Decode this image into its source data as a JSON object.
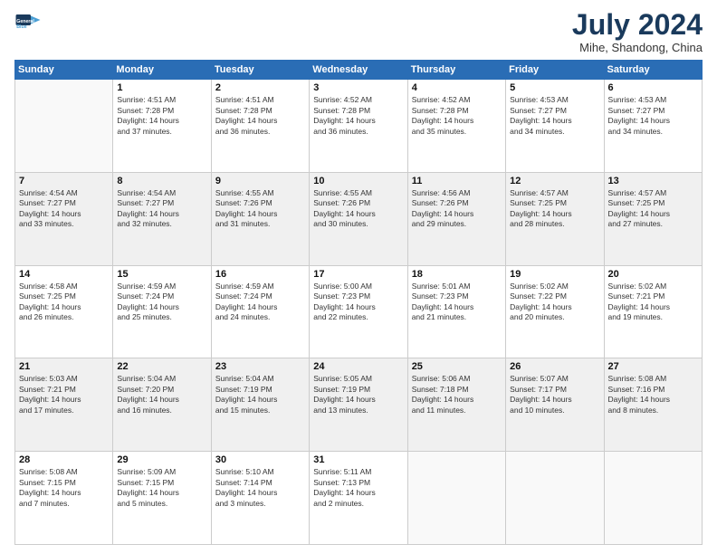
{
  "logo": {
    "line1": "General",
    "line2": "Blue"
  },
  "title": "July 2024",
  "subtitle": "Mihe, Shandong, China",
  "days_header": [
    "Sunday",
    "Monday",
    "Tuesday",
    "Wednesday",
    "Thursday",
    "Friday",
    "Saturday"
  ],
  "weeks": [
    [
      {
        "day": "",
        "info": ""
      },
      {
        "day": "1",
        "info": "Sunrise: 4:51 AM\nSunset: 7:28 PM\nDaylight: 14 hours\nand 37 minutes."
      },
      {
        "day": "2",
        "info": "Sunrise: 4:51 AM\nSunset: 7:28 PM\nDaylight: 14 hours\nand 36 minutes."
      },
      {
        "day": "3",
        "info": "Sunrise: 4:52 AM\nSunset: 7:28 PM\nDaylight: 14 hours\nand 36 minutes."
      },
      {
        "day": "4",
        "info": "Sunrise: 4:52 AM\nSunset: 7:28 PM\nDaylight: 14 hours\nand 35 minutes."
      },
      {
        "day": "5",
        "info": "Sunrise: 4:53 AM\nSunset: 7:27 PM\nDaylight: 14 hours\nand 34 minutes."
      },
      {
        "day": "6",
        "info": "Sunrise: 4:53 AM\nSunset: 7:27 PM\nDaylight: 14 hours\nand 34 minutes."
      }
    ],
    [
      {
        "day": "7",
        "info": "Sunrise: 4:54 AM\nSunset: 7:27 PM\nDaylight: 14 hours\nand 33 minutes."
      },
      {
        "day": "8",
        "info": "Sunrise: 4:54 AM\nSunset: 7:27 PM\nDaylight: 14 hours\nand 32 minutes."
      },
      {
        "day": "9",
        "info": "Sunrise: 4:55 AM\nSunset: 7:26 PM\nDaylight: 14 hours\nand 31 minutes."
      },
      {
        "day": "10",
        "info": "Sunrise: 4:55 AM\nSunset: 7:26 PM\nDaylight: 14 hours\nand 30 minutes."
      },
      {
        "day": "11",
        "info": "Sunrise: 4:56 AM\nSunset: 7:26 PM\nDaylight: 14 hours\nand 29 minutes."
      },
      {
        "day": "12",
        "info": "Sunrise: 4:57 AM\nSunset: 7:25 PM\nDaylight: 14 hours\nand 28 minutes."
      },
      {
        "day": "13",
        "info": "Sunrise: 4:57 AM\nSunset: 7:25 PM\nDaylight: 14 hours\nand 27 minutes."
      }
    ],
    [
      {
        "day": "14",
        "info": "Sunrise: 4:58 AM\nSunset: 7:25 PM\nDaylight: 14 hours\nand 26 minutes."
      },
      {
        "day": "15",
        "info": "Sunrise: 4:59 AM\nSunset: 7:24 PM\nDaylight: 14 hours\nand 25 minutes."
      },
      {
        "day": "16",
        "info": "Sunrise: 4:59 AM\nSunset: 7:24 PM\nDaylight: 14 hours\nand 24 minutes."
      },
      {
        "day": "17",
        "info": "Sunrise: 5:00 AM\nSunset: 7:23 PM\nDaylight: 14 hours\nand 22 minutes."
      },
      {
        "day": "18",
        "info": "Sunrise: 5:01 AM\nSunset: 7:23 PM\nDaylight: 14 hours\nand 21 minutes."
      },
      {
        "day": "19",
        "info": "Sunrise: 5:02 AM\nSunset: 7:22 PM\nDaylight: 14 hours\nand 20 minutes."
      },
      {
        "day": "20",
        "info": "Sunrise: 5:02 AM\nSunset: 7:21 PM\nDaylight: 14 hours\nand 19 minutes."
      }
    ],
    [
      {
        "day": "21",
        "info": "Sunrise: 5:03 AM\nSunset: 7:21 PM\nDaylight: 14 hours\nand 17 minutes."
      },
      {
        "day": "22",
        "info": "Sunrise: 5:04 AM\nSunset: 7:20 PM\nDaylight: 14 hours\nand 16 minutes."
      },
      {
        "day": "23",
        "info": "Sunrise: 5:04 AM\nSunset: 7:19 PM\nDaylight: 14 hours\nand 15 minutes."
      },
      {
        "day": "24",
        "info": "Sunrise: 5:05 AM\nSunset: 7:19 PM\nDaylight: 14 hours\nand 13 minutes."
      },
      {
        "day": "25",
        "info": "Sunrise: 5:06 AM\nSunset: 7:18 PM\nDaylight: 14 hours\nand 11 minutes."
      },
      {
        "day": "26",
        "info": "Sunrise: 5:07 AM\nSunset: 7:17 PM\nDaylight: 14 hours\nand 10 minutes."
      },
      {
        "day": "27",
        "info": "Sunrise: 5:08 AM\nSunset: 7:16 PM\nDaylight: 14 hours\nand 8 minutes."
      }
    ],
    [
      {
        "day": "28",
        "info": "Sunrise: 5:08 AM\nSunset: 7:15 PM\nDaylight: 14 hours\nand 7 minutes."
      },
      {
        "day": "29",
        "info": "Sunrise: 5:09 AM\nSunset: 7:15 PM\nDaylight: 14 hours\nand 5 minutes."
      },
      {
        "day": "30",
        "info": "Sunrise: 5:10 AM\nSunset: 7:14 PM\nDaylight: 14 hours\nand 3 minutes."
      },
      {
        "day": "31",
        "info": "Sunrise: 5:11 AM\nSunset: 7:13 PM\nDaylight: 14 hours\nand 2 minutes."
      },
      {
        "day": "",
        "info": ""
      },
      {
        "day": "",
        "info": ""
      },
      {
        "day": "",
        "info": ""
      }
    ]
  ]
}
